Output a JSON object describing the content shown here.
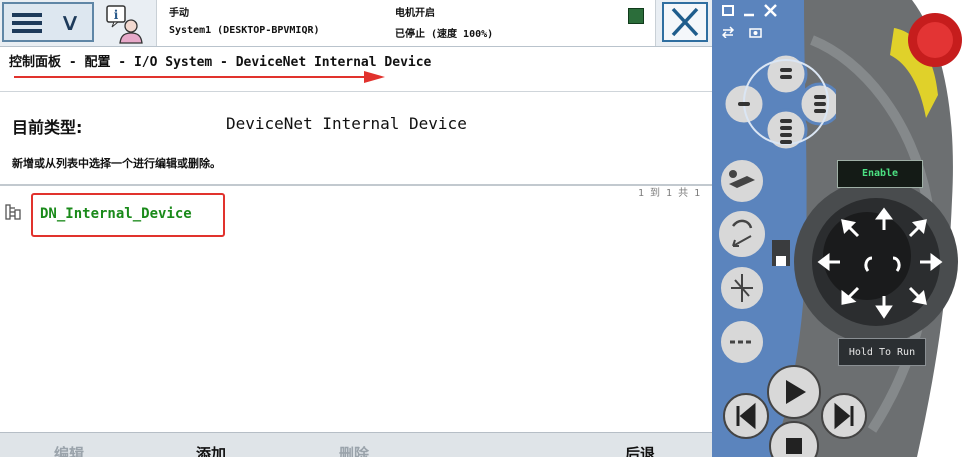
{
  "status": {
    "mode": "手动",
    "system": "System1 (DESKTOP-BPVMIQR)",
    "motors": "电机开启",
    "run_state": "已停止 (速度 100%)"
  },
  "breadcrumb": "控制面板 - 配置 - I/O System - DeviceNet Internal Device",
  "current_type": {
    "label": "目前类型:",
    "value": "DeviceNet Internal Device"
  },
  "instruction": "新增或从列表中选择一个进行编辑或删除。",
  "pager": "1 到 1 共 1",
  "list": {
    "items": [
      "DN_Internal_Device"
    ]
  },
  "bottom": {
    "edit": "编辑",
    "add": "添加",
    "delete": "删除",
    "back": "后退"
  },
  "jog": {
    "enable": "Enable",
    "hold_to_run": "Hold To Run"
  },
  "colors": {
    "accent_blue": "#2f6ea0",
    "highlight_red": "#e1322d",
    "item_green": "#1a8a1a",
    "panel_blue": "#5b84bd"
  }
}
